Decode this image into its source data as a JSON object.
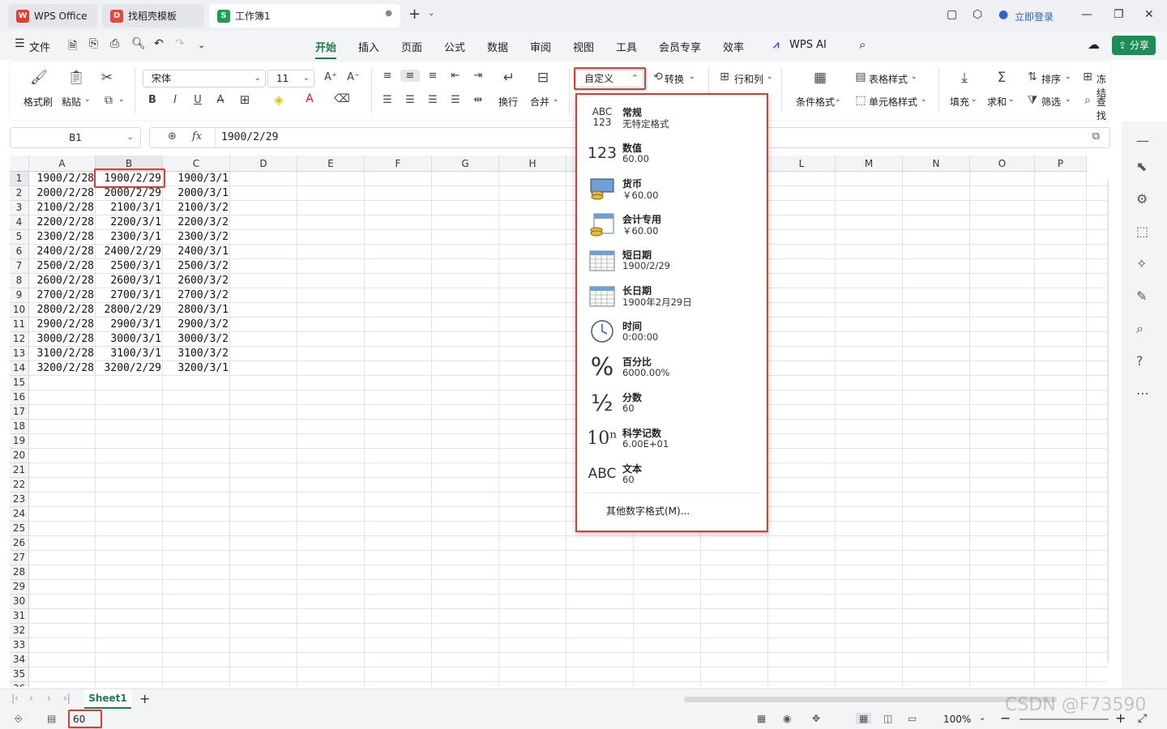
{
  "tabs": [
    {
      "label": "WPS Office",
      "logo": "W",
      "color": "#e43d30"
    },
    {
      "label": "找稻壳模板",
      "logo": "D",
      "color": "#e8453c"
    },
    {
      "label": "工作簿1",
      "logo": "S",
      "color": "#1a9f53"
    }
  ],
  "window": {
    "login": "立即登录"
  },
  "menu": {
    "file": "文件",
    "tabs": [
      "开始",
      "插入",
      "页面",
      "公式",
      "数据",
      "审阅",
      "视图",
      "工具",
      "会员专享",
      "效率"
    ],
    "active": "开始",
    "wps_ai": "WPS AI",
    "share": "分享"
  },
  "ribbon": {
    "format_painter": "格式刷",
    "paste": "粘贴",
    "font_name": "宋体",
    "font_size": "11",
    "wrap": "换行",
    "merge": "合并",
    "number_format": "自定义",
    "convert": "转换",
    "row_col": "行和列",
    "cond_format": "条件格式",
    "table_style": "表格样式",
    "cell_style": "单元格样式",
    "fill": "填充",
    "sum": "求和",
    "sort": "排序",
    "filter": "筛选",
    "freeze": "冻结",
    "find": "查找"
  },
  "formula_bar": {
    "name_box": "B1",
    "fx": "fx",
    "content": "1900/2/29"
  },
  "columns": [
    "A",
    "B",
    "C",
    "D",
    "E",
    "F",
    "G",
    "H",
    "",
    "",
    "",
    "L",
    "M",
    "N",
    "O",
    "P"
  ],
  "rows": [
    [
      "1900/2/28",
      "1900/2/29",
      "1900/3/1"
    ],
    [
      "2000/2/28",
      "2000/2/29",
      "2000/3/1"
    ],
    [
      "2100/2/28",
      "2100/3/1",
      "2100/3/2"
    ],
    [
      "2200/2/28",
      "2200/3/1",
      "2200/3/2"
    ],
    [
      "2300/2/28",
      "2300/3/1",
      "2300/3/2"
    ],
    [
      "2400/2/28",
      "2400/2/29",
      "2400/3/1"
    ],
    [
      "2500/2/28",
      "2500/3/1",
      "2500/3/2"
    ],
    [
      "2600/2/28",
      "2600/3/1",
      "2600/3/2"
    ],
    [
      "2700/2/28",
      "2700/3/1",
      "2700/3/2"
    ],
    [
      "2800/2/28",
      "2800/2/29",
      "2800/3/1"
    ],
    [
      "2900/2/28",
      "2900/3/1",
      "2900/3/2"
    ],
    [
      "3000/2/28",
      "3000/3/1",
      "3000/3/2"
    ],
    [
      "3100/2/28",
      "3100/3/1",
      "3100/3/2"
    ],
    [
      "3200/2/28",
      "3200/2/29",
      "3200/3/1"
    ]
  ],
  "row_count": 36,
  "number_formats": [
    {
      "name": "常规",
      "sample": "无特定格式",
      "icon": "ABC 123"
    },
    {
      "name": "数值",
      "sample": "60.00",
      "icon": "123"
    },
    {
      "name": "货币",
      "sample": "￥60.00",
      "icon": "coins-icon"
    },
    {
      "name": "会计专用",
      "sample": "￥60.00",
      "icon": "ledger-icon"
    },
    {
      "name": "短日期",
      "sample": "1900/2/29",
      "icon": "calendar-icon"
    },
    {
      "name": "长日期",
      "sample": "1900年2月29日",
      "icon": "calendar-icon"
    },
    {
      "name": "时间",
      "sample": "0:00:00",
      "icon": "clock-icon"
    },
    {
      "name": "百分比",
      "sample": "6000.00%",
      "icon": "%"
    },
    {
      "name": "分数",
      "sample": "60",
      "icon": "½"
    },
    {
      "name": "科学记数",
      "sample": "6.00E+01",
      "icon": "10ⁿ"
    },
    {
      "name": "文本",
      "sample": "60",
      "icon": "ABC"
    }
  ],
  "more_formats": "其他数字格式(M)...",
  "sheet": {
    "name": "Sheet1"
  },
  "status": {
    "value": "60",
    "zoom": "100%"
  },
  "watermark": "CSDN @F73590",
  "colors": {
    "accent": "#1a7f4b",
    "highlight": "#e03b2e"
  }
}
